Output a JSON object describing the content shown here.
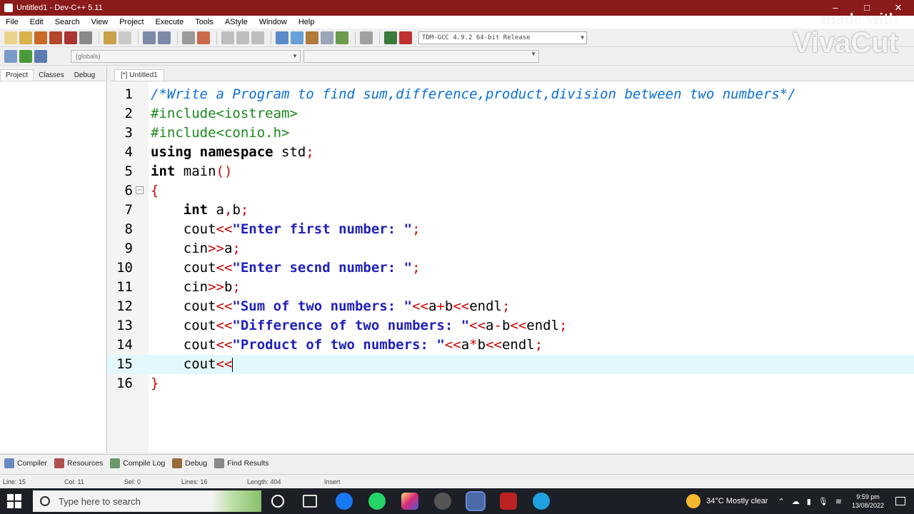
{
  "window": {
    "title": "Untitled1 - Dev-C++ 5.11",
    "controls": [
      "–",
      "□",
      "✕"
    ]
  },
  "menu": [
    "File",
    "Edit",
    "Search",
    "View",
    "Project",
    "Execute",
    "Tools",
    "AStyle",
    "Window",
    "Help"
  ],
  "toolbar": {
    "compiler": "TDM-GCC 4.9.2 64-bit Release",
    "scope": "(globals)"
  },
  "left_panel": {
    "tabs": [
      "Project",
      "Classes",
      "Debug"
    ]
  },
  "editor": {
    "tab_label": "[*] Untitled1",
    "current_line": 15,
    "lines": [
      {
        "n": "1",
        "segs": [
          [
            "c-comment",
            "/*Write a Program to find sum,difference,product,division between two numbers*/"
          ]
        ]
      },
      {
        "n": "2",
        "segs": [
          [
            "c-pre",
            "#include<iostream>"
          ]
        ]
      },
      {
        "n": "3",
        "segs": [
          [
            "c-pre",
            "#include<conio.h>"
          ]
        ]
      },
      {
        "n": "4",
        "segs": [
          [
            "c-kw",
            "using namespace"
          ],
          [
            "c-plain",
            " std"
          ],
          [
            "c-op",
            ";"
          ]
        ]
      },
      {
        "n": "5",
        "segs": [
          [
            "c-kw",
            "int"
          ],
          [
            "c-plain",
            " main"
          ],
          [
            "c-op",
            "()"
          ]
        ]
      },
      {
        "n": "6",
        "fold": true,
        "segs": [
          [
            "c-op",
            "{"
          ]
        ]
      },
      {
        "n": "7",
        "segs": [
          [
            "c-plain",
            "    "
          ],
          [
            "c-kw",
            "int"
          ],
          [
            "c-plain",
            " a"
          ],
          [
            "c-op",
            ","
          ],
          [
            "c-plain",
            "b"
          ],
          [
            "c-op",
            ";"
          ]
        ]
      },
      {
        "n": "8",
        "segs": [
          [
            "c-plain",
            "    cout"
          ],
          [
            "c-op",
            "<<"
          ],
          [
            "c-str",
            "\"Enter first number: \""
          ],
          [
            "c-op",
            ";"
          ]
        ]
      },
      {
        "n": "9",
        "segs": [
          [
            "c-plain",
            "    cin"
          ],
          [
            "c-op",
            ">>"
          ],
          [
            "c-plain",
            "a"
          ],
          [
            "c-op",
            ";"
          ]
        ]
      },
      {
        "n": "10",
        "segs": [
          [
            "c-plain",
            "    cout"
          ],
          [
            "c-op",
            "<<"
          ],
          [
            "c-str",
            "\"Enter secnd number: \""
          ],
          [
            "c-op",
            ";"
          ]
        ]
      },
      {
        "n": "11",
        "segs": [
          [
            "c-plain",
            "    cin"
          ],
          [
            "c-op",
            ">>"
          ],
          [
            "c-plain",
            "b"
          ],
          [
            "c-op",
            ";"
          ]
        ]
      },
      {
        "n": "12",
        "segs": [
          [
            "c-plain",
            "    cout"
          ],
          [
            "c-op",
            "<<"
          ],
          [
            "c-str",
            "\"Sum of two numbers: \""
          ],
          [
            "c-op",
            "<<"
          ],
          [
            "c-plain",
            "a"
          ],
          [
            "c-op",
            "+"
          ],
          [
            "c-plain",
            "b"
          ],
          [
            "c-op",
            "<<"
          ],
          [
            "c-plain",
            "endl"
          ],
          [
            "c-op",
            ";"
          ]
        ]
      },
      {
        "n": "13",
        "segs": [
          [
            "c-plain",
            "    cout"
          ],
          [
            "c-op",
            "<<"
          ],
          [
            "c-str",
            "\"Difference of two numbers: \""
          ],
          [
            "c-op",
            "<<"
          ],
          [
            "c-plain",
            "a"
          ],
          [
            "c-op",
            "-"
          ],
          [
            "c-plain",
            "b"
          ],
          [
            "c-op",
            "<<"
          ],
          [
            "c-plain",
            "endl"
          ],
          [
            "c-op",
            ";"
          ]
        ]
      },
      {
        "n": "14",
        "segs": [
          [
            "c-plain",
            "    cout"
          ],
          [
            "c-op",
            "<<"
          ],
          [
            "c-str",
            "\"Product of two numbers: \""
          ],
          [
            "c-op",
            "<<"
          ],
          [
            "c-plain",
            "a"
          ],
          [
            "c-op",
            "*"
          ],
          [
            "c-plain",
            "b"
          ],
          [
            "c-op",
            "<<"
          ],
          [
            "c-plain",
            "endl"
          ],
          [
            "c-op",
            ";"
          ]
        ]
      },
      {
        "n": "15",
        "caret": true,
        "segs": [
          [
            "c-plain",
            "    cout"
          ],
          [
            "c-op",
            "<<"
          ]
        ]
      },
      {
        "n": "16",
        "segs": [
          [
            "c-op",
            "}"
          ]
        ]
      }
    ]
  },
  "bottom_tabs": [
    "Compiler",
    "Resources",
    "Compile Log",
    "Debug",
    "Find Results"
  ],
  "status": {
    "line": "Line: 15",
    "col": "Col: 11",
    "sel": "Sel: 0",
    "lines": "Lines: 16",
    "length": "Length: 404",
    "mode": "Insert"
  },
  "watermark": {
    "small": "made with",
    "big": "VivaCut"
  },
  "taskbar": {
    "search_placeholder": "Type here to search",
    "weather": "34°C  Mostly clear",
    "time": "9:59 pm",
    "date": "13/08/2022"
  }
}
